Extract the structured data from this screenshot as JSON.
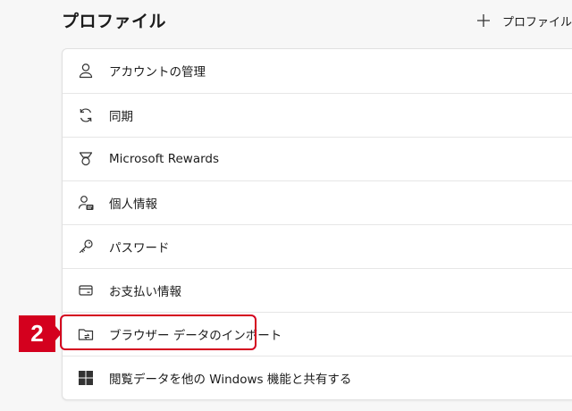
{
  "header": {
    "title": "プロファイル",
    "add_profile_label": "プロファイルの追"
  },
  "menu": {
    "items": [
      {
        "label": "アカウントの管理",
        "icon": "person-icon"
      },
      {
        "label": "同期",
        "icon": "sync-icon"
      },
      {
        "label": "Microsoft Rewards",
        "icon": "rewards-medal-icon"
      },
      {
        "label": "個人情報",
        "icon": "person-card-icon"
      },
      {
        "label": "パスワード",
        "icon": "key-icon"
      },
      {
        "label": "お支払い情報",
        "icon": "credit-card-icon"
      },
      {
        "label": "ブラウザー データのインポート",
        "icon": "folder-import-icon"
      },
      {
        "label": "閲覧データを他の Windows 機能と共有する",
        "icon": "windows-icon"
      }
    ]
  },
  "annotation": {
    "step_number": "2",
    "color": "#d4001e"
  }
}
